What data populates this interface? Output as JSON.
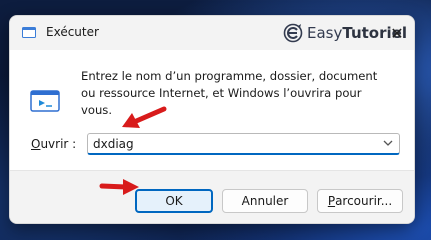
{
  "dialog": {
    "title": "Exécuter",
    "close_symbol": "✕",
    "icon": "run-dialog-icon",
    "brand": {
      "prefix": "Easy",
      "suffix": "Tutoriel"
    }
  },
  "body": {
    "message": "Entrez le nom d’un programme, dossier, document ou ressource Internet, et Windows l’ouvrira pour vous.",
    "open_label_underlined": "O",
    "open_label_rest": "uvrir :",
    "input_value": "dxdiag"
  },
  "buttons": {
    "ok_label": "OK",
    "cancel_label": "Annuler",
    "browse_underlined": "P",
    "browse_rest": "arcourir..."
  },
  "colors": {
    "accent": "#0067c0",
    "annotation_arrow": "#d81b1b"
  }
}
